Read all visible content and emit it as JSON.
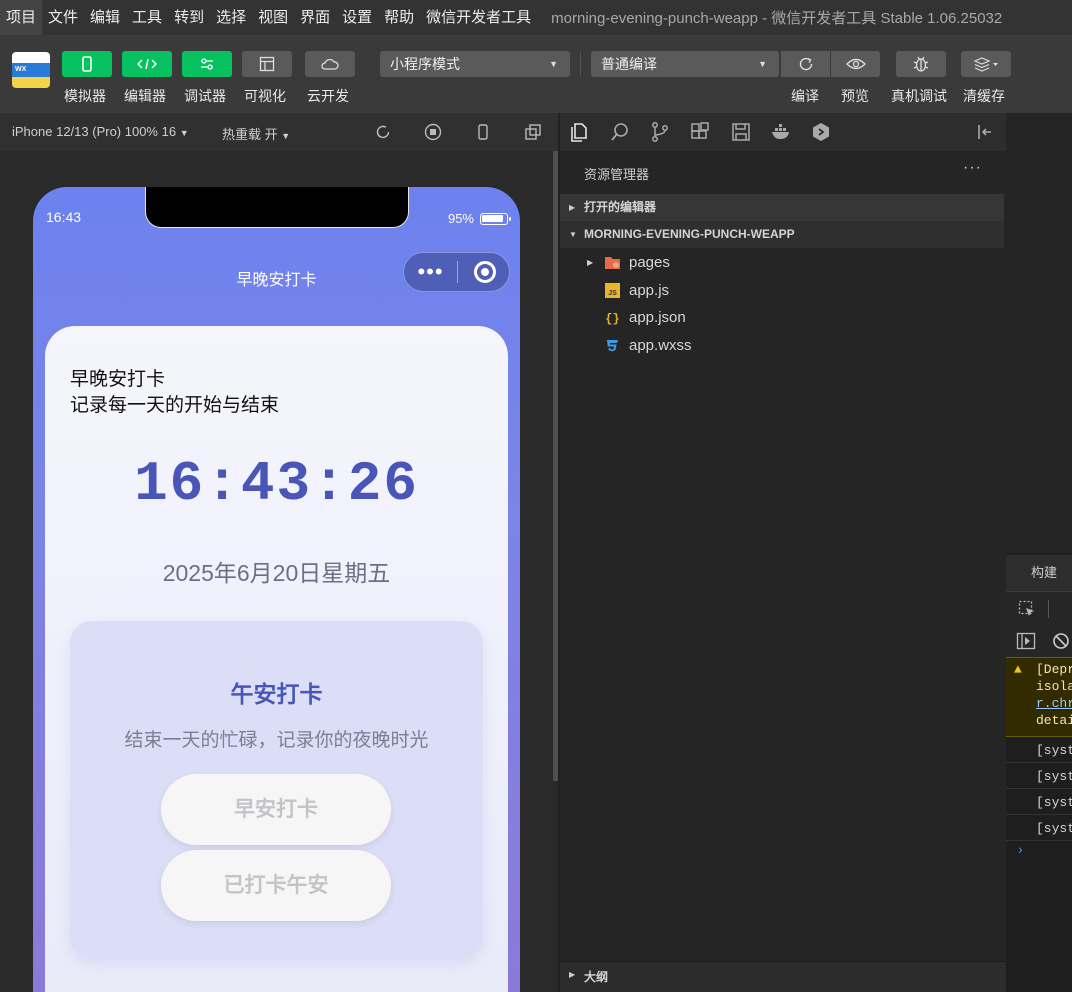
{
  "menu": {
    "items": [
      "项目",
      "文件",
      "编辑",
      "工具",
      "转到",
      "选择",
      "视图",
      "界面",
      "设置",
      "帮助",
      "微信开发者工具"
    ],
    "window_title": "morning-evening-punch-weapp - 微信开发者工具 Stable 1.06.25032"
  },
  "toolbar": {
    "simulator": "模拟器",
    "editor": "编辑器",
    "debugger": "调试器",
    "visual": "可视化",
    "cloud": "云开发",
    "mode_select": "小程序模式",
    "compile_select": "普通编译",
    "compile": "编译",
    "preview": "预览",
    "remote_debug": "真机调试",
    "clear_cache": "清缓存"
  },
  "simulator_bar": {
    "device": "iPhone 12/13 (Pro) 100% 16",
    "hot_reload": "热重载 开"
  },
  "phone": {
    "status_time": "16:43",
    "battery": "95%",
    "nav_title": "早晚安打卡",
    "app_title": "早晚安打卡",
    "app_subtitle": "记录每一天的开始与结束",
    "clock": "16:43:26",
    "date": "2025年6月20日星期五",
    "section_title": "午安打卡",
    "section_desc": "结束一天的忙碌，记录你的夜晚时光",
    "btn_morning": "早安打卡",
    "btn_done": "已打卡午安"
  },
  "explorer": {
    "header": "资源管理器",
    "more": "···",
    "open_editors": "打开的编辑器",
    "project": "MORNING-EVENING-PUNCH-WEAPP",
    "files": [
      "pages",
      "app.js",
      "app.json",
      "app.wxss"
    ],
    "outline": "大纲"
  },
  "console": {
    "tab": "构建",
    "warning_lines": [
      "[Depr",
      "isola",
      "r.chr",
      "detai"
    ],
    "logs": [
      "[syst",
      "[syst",
      "[syst",
      "[syst"
    ],
    "prompt": "›"
  },
  "colors": {
    "green": "#07c160",
    "accent": "#4a55b8"
  }
}
